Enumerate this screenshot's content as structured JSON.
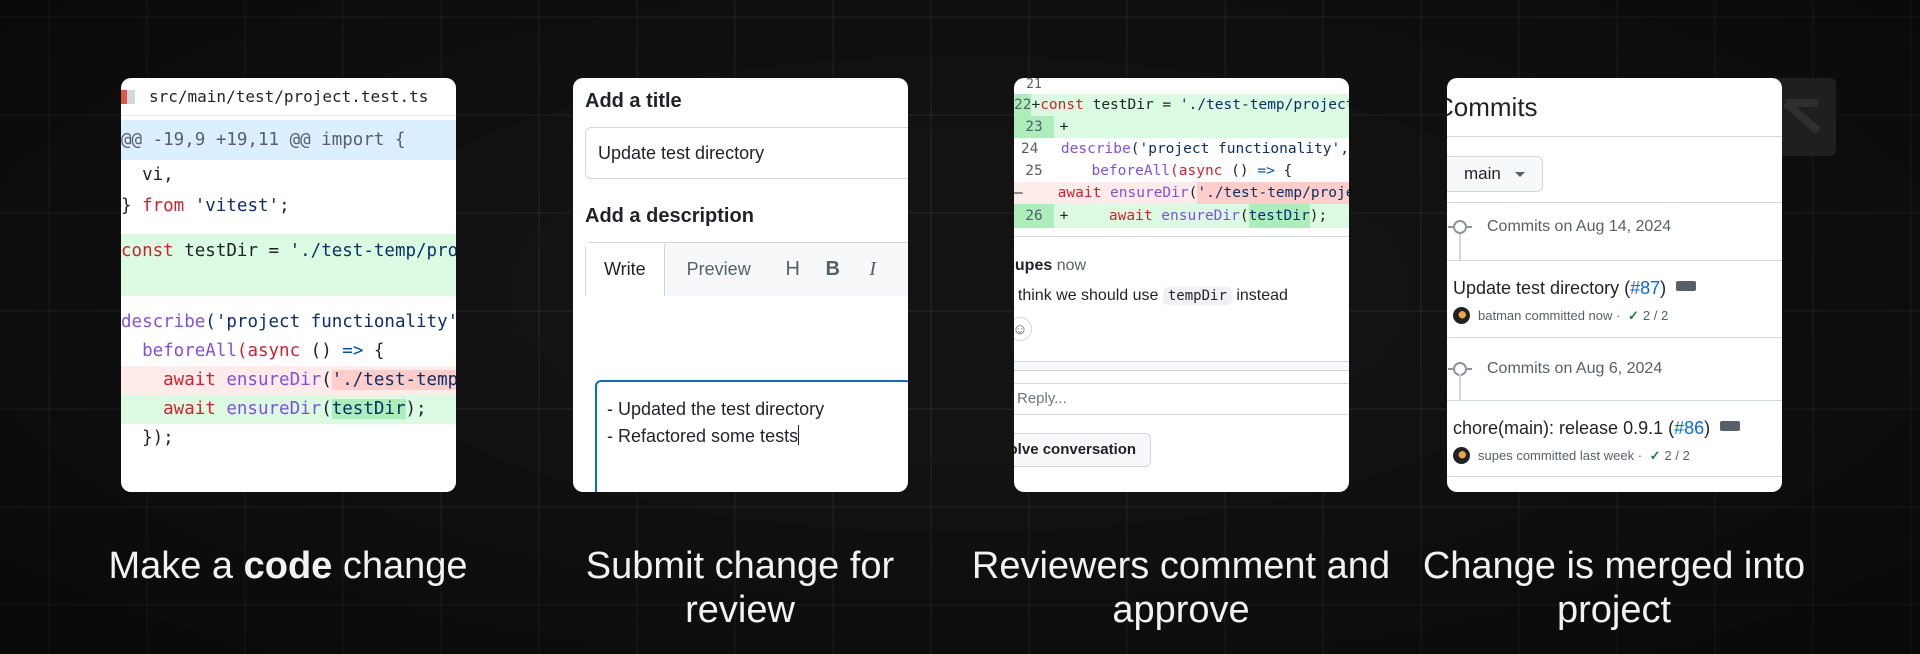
{
  "steps": [
    {
      "caption_pre": "Make a ",
      "caption_bold": "code",
      "caption_post": " change"
    },
    {
      "caption": "Submit change for review"
    },
    {
      "caption": "Reviewers comment and approve"
    },
    {
      "caption": "Change is merged into project"
    }
  ],
  "code_card": {
    "file_path": "src/main/test/project.test.ts",
    "hunk": "@@ -19,9 +19,11 @@ import {",
    "lines": {
      "l1": "  vi,",
      "l2_a": "} ",
      "l2_kw": "from",
      "l2_str": " 'vitest'",
      "l2_end": ";",
      "l3_kw": "const",
      "l3_mid": " testDir = ",
      "l3_str": "'./test-temp/project'",
      "l4_fn": "describe",
      "l4_str": "('project functionality'",
      "l5_fn": "  beforeAll",
      "l5_kw": "(async",
      "l5_mid": " () ",
      "l5_arrow": "=>",
      "l5_end": " {",
      "l6_kw": "    await",
      "l6_fn": " ensureDir",
      "l6_p": "(",
      "l6_str": "'./test-temp/project'",
      "l7_kw": "    await",
      "l7_fn": " ensureDir",
      "l7_p": "(",
      "l7_hl": "testDir",
      "l7_end": ");",
      "l8": "  });"
    }
  },
  "pr_card": {
    "title_label": "Add a title",
    "title_value": "Update test directory",
    "desc_label": "Add a description",
    "tab_write": "Write",
    "tab_preview": "Preview",
    "tool_h": "H",
    "tool_b": "B",
    "tool_i": "I",
    "desc_line1": "- Updated the test directory",
    "desc_line2": "- Refactored some tests"
  },
  "review_card": {
    "rows": [
      {
        "ln": "21",
        "sg": "",
        "code": ""
      },
      {
        "ln": "22",
        "sg": "+",
        "kw": "const",
        "mid": " testDir = ",
        "str": "'./test-temp/project'"
      },
      {
        "ln": "23",
        "sg": "+"
      },
      {
        "ln": "24",
        "fn": "describe",
        "str": "('project functionality',"
      },
      {
        "ln": "25",
        "fn": "  beforeAll",
        "kw": "(async",
        "mid": " () ",
        "arrow": "=>",
        "end": " {"
      },
      {
        "ln": "",
        "sg": "–",
        "kw": "    await",
        "fn": " ensureDir",
        "p": "(",
        "str": "'./test-temp/project'"
      },
      {
        "ln": "26",
        "sg": "+",
        "kw": "    await",
        "fn": " ensureDir",
        "p": "(",
        "hl": "testDir",
        "end": ");"
      }
    ],
    "user": "supes",
    "time": " now",
    "comment_pre": "I think we should use ",
    "comment_code": "tempDir",
    "comment_post": " instead",
    "reply_placeholder": "Reply...",
    "resolve_label": "Resolve conversation"
  },
  "commits_card": {
    "title": "Commits",
    "branch": "main",
    "groups": [
      {
        "date": "Commits on Aug 14, 2024",
        "title": "Update test directory (",
        "pr": "#87",
        "close": ")",
        "author": "batman",
        "when": " committed now · ",
        "checks": "2 / 2"
      },
      {
        "date": "Commits on Aug 6, 2024",
        "title": "chore(main): release 0.9.1 (",
        "pr": "#86",
        "close": ")",
        "author": "supes",
        "when": " committed last week · ",
        "checks": "2 / 2"
      }
    ]
  },
  "icons": [
    "file-icon",
    "smiley-icon",
    "commit-dot-icon",
    "check-icon",
    "kebab-icon",
    "avatar",
    "dropdown-caret-icon",
    "slash-logo-icon"
  ]
}
